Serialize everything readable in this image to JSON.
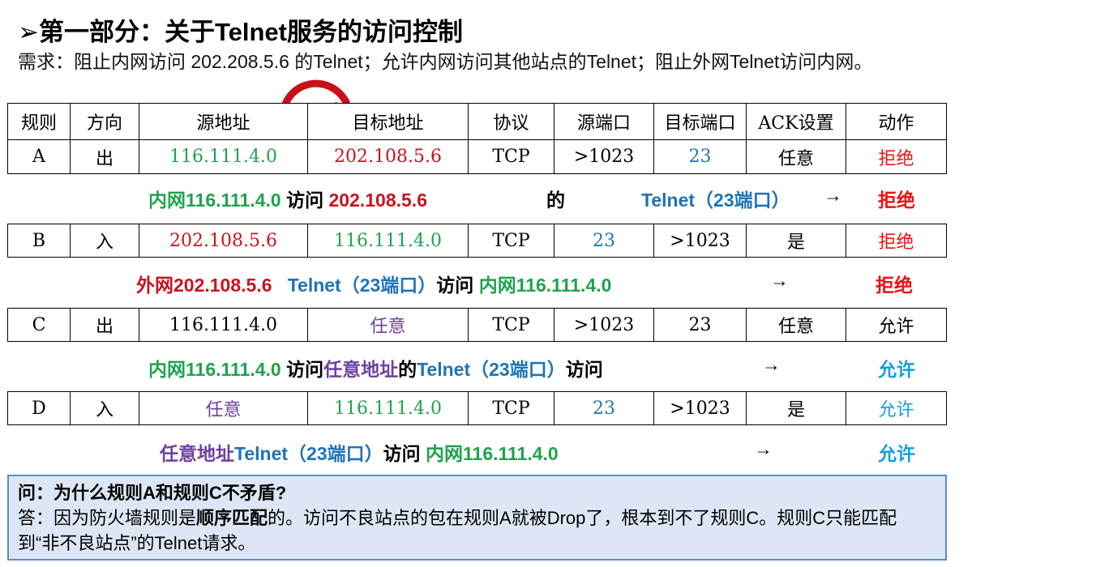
{
  "title": "➢第一部分：关于Telnet服务的访问控制",
  "requirement": "需求：阻止内网访问 202.208.5.6 的Telnet；允许内网访问其他站点的Telnet；阻止外网Telnet访问内网。",
  "headers": [
    "规则",
    "方向",
    "源地址",
    "目标地址",
    "协议",
    "源端口",
    "目标端口",
    "ACK设置",
    "动作"
  ],
  "rows": [
    [
      "A",
      "出",
      "116.111.4.0",
      "202.108.5.6",
      "TCP",
      ">1023",
      "23",
      "任意",
      "拒绝"
    ],
    [
      "B",
      "入",
      "202.108.5.6",
      "116.111.4.0",
      "TCP",
      "23",
      ">1023",
      "是",
      "拒绝"
    ],
    [
      "C",
      "出",
      "116.111.4.0",
      "任意",
      "TCP",
      ">1023",
      "23",
      "任意",
      "允许"
    ],
    [
      "D",
      "入",
      "任意",
      "116.111.4.0",
      "TCP",
      "23",
      ">1023",
      "是",
      "允许"
    ]
  ],
  "explanations": {
    "a": {
      "src": "内网116.111.4.0",
      "verb": "访问",
      "dst": "202.108.5.6",
      "de": "的",
      "svc": "Telnet（23端口）",
      "arrow": "→",
      "action": "拒绝"
    },
    "b": {
      "src": "外网202.108.5.6",
      "svc": "Telnet（23端口）",
      "verb": "访问",
      "dst": "内网116.111.4.0",
      "arrow": "→",
      "action": "拒绝"
    },
    "c": {
      "src": "内网116.111.4.0",
      "verb": "访问",
      "any": "任意地址",
      "de": "的",
      "svc": "Telnet（23端口）",
      "verb2": "访问",
      "arrow": "→",
      "action": "允许"
    },
    "d": {
      "any": "任意地址",
      "svc": "Telnet（23端口）",
      "verb": "访问",
      "dst": "内网116.111.4.0",
      "arrow": "→",
      "action": "允许"
    }
  },
  "qa": {
    "question": "问：为什么规则A和规则C不矛盾?",
    "answer_pre": "答：因为防火墙规则是",
    "answer_bold": "顺序匹配",
    "answer_post": "的。访问不良站点的包在规则A就被Drop了，根本到不了规则C。规则C只能匹配到“非不良站点”的Telnet请求。"
  },
  "colors": {
    "green": "#1fa34d",
    "red": "#c8141e",
    "blue": "#1f73b8",
    "purple": "#7040a0",
    "bright_red": "#ee1111",
    "light_blue": "#17a0e0",
    "qa_bg": "#dde6f4"
  }
}
